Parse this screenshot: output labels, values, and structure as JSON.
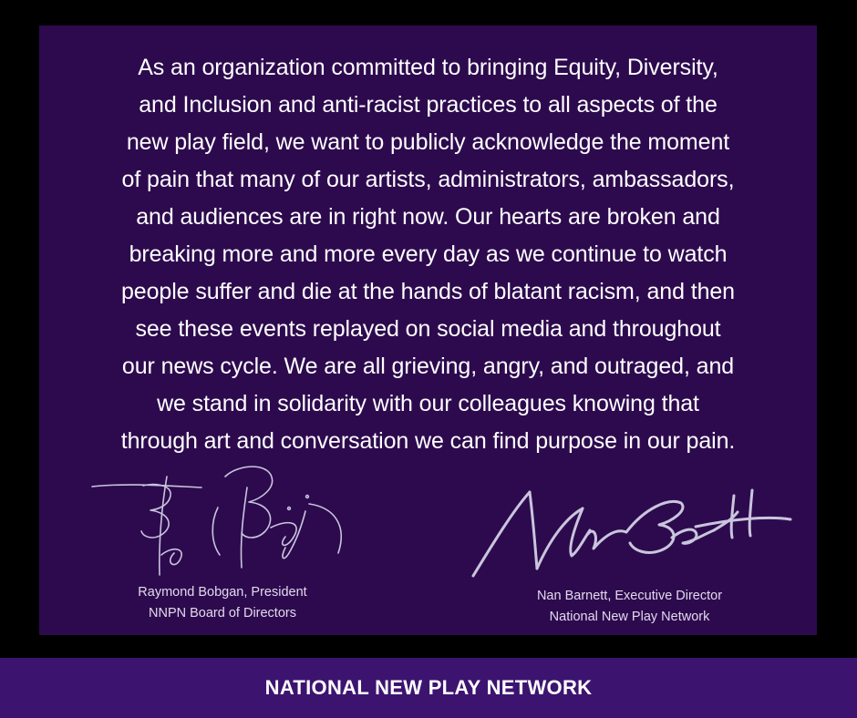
{
  "statement": {
    "lines": [
      "As an organization committed to bringing Equity, Diversity,",
      "and Inclusion and anti-racist practices to all aspects of the",
      "new play field, we want to publicly acknowledge the moment",
      "of pain that many of our artists, administrators, ambassadors,",
      "and audiences are in right now. Our hearts are broken and",
      "breaking more and more every day as we continue to watch",
      "people suffer and die at the hands of blatant racism, and then",
      "see these events replayed on social media and throughout",
      "our news cycle. We are all grieving, angry, and outraged, and",
      "we stand in solidarity with our colleagues knowing that",
      "through art and conversation we can find purpose in our pain."
    ]
  },
  "signatures": {
    "left": {
      "signature_text": "Bobgan",
      "name_title": "Raymond Bobgan, President",
      "organization": "NNPN Board of Directors"
    },
    "right": {
      "signature_text": "Nan Barnett",
      "name_title": "Nan Barnett, Executive Director",
      "organization": "National New Play Network"
    }
  },
  "footer": {
    "brand_name": "NATIONAL NEW PLAY NETWORK"
  },
  "colors": {
    "page_background": "#000000",
    "panel_background": "#2d0a4e",
    "footer_background": "#3c1470",
    "text": "#ffffff",
    "signature_ink": "#c9c5dd"
  }
}
